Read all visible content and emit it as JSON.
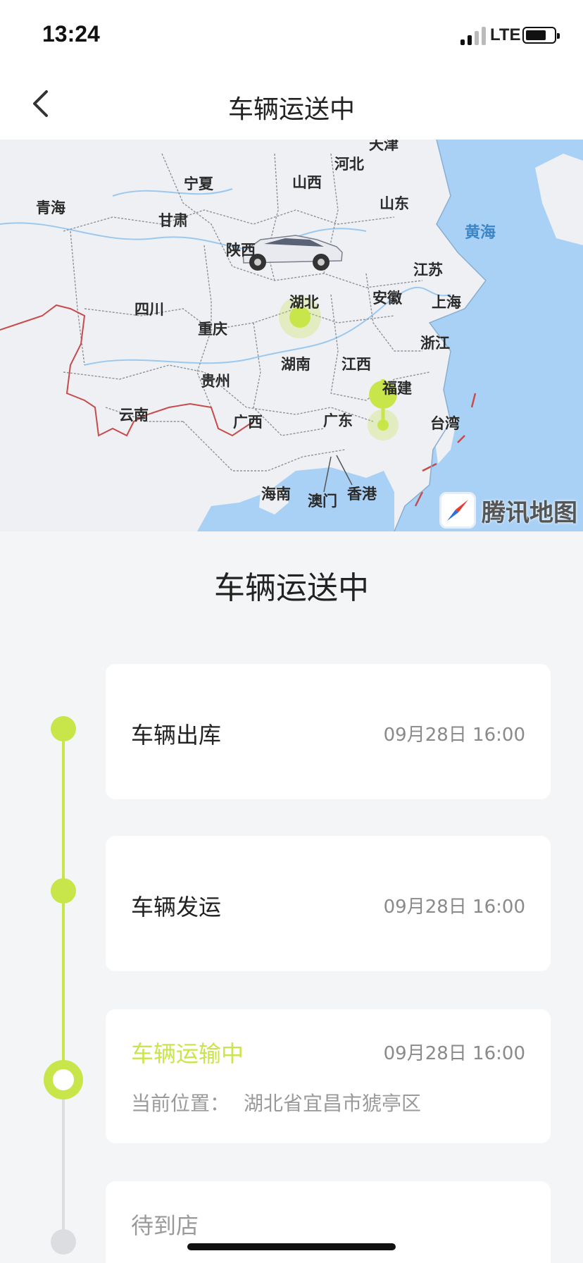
{
  "status_bar": {
    "time": "13:24",
    "network": "LTE"
  },
  "nav": {
    "title": "车辆运送中",
    "back_icon": "chevron-left-icon"
  },
  "map": {
    "labels": [
      "天津",
      "河北",
      "宁夏",
      "山西",
      "青海",
      "甘肃",
      "山东",
      "黄海",
      "陕西",
      "江苏",
      "四川",
      "湖北",
      "安徽",
      "上海",
      "重庆",
      "浙江",
      "湖南",
      "江西",
      "贵州",
      "福建",
      "云南",
      "广西",
      "广东",
      "台湾",
      "海南",
      "澳门",
      "香港"
    ],
    "provider": "腾讯地图",
    "colors": {
      "land": "#eef0f4",
      "sea": "#a9d1f5",
      "border": "#c84b4b",
      "marker": "#c8e64a"
    }
  },
  "section": {
    "title": "车辆运送中"
  },
  "timeline": {
    "accent_color": "#c8e64a",
    "inactive_color": "#dcdde1",
    "steps": [
      {
        "title": "车辆出库",
        "time": "09月28日 16:00",
        "status": "done"
      },
      {
        "title": "车辆发运",
        "time": "09月28日 16:00",
        "status": "done"
      },
      {
        "title": "车辆运输中",
        "time": "09月28日 16:00",
        "status": "current",
        "location_label": "当前位置：",
        "location_value": "湖北省宜昌市猇亭区"
      },
      {
        "title": "待到店",
        "status": "pending"
      }
    ]
  }
}
